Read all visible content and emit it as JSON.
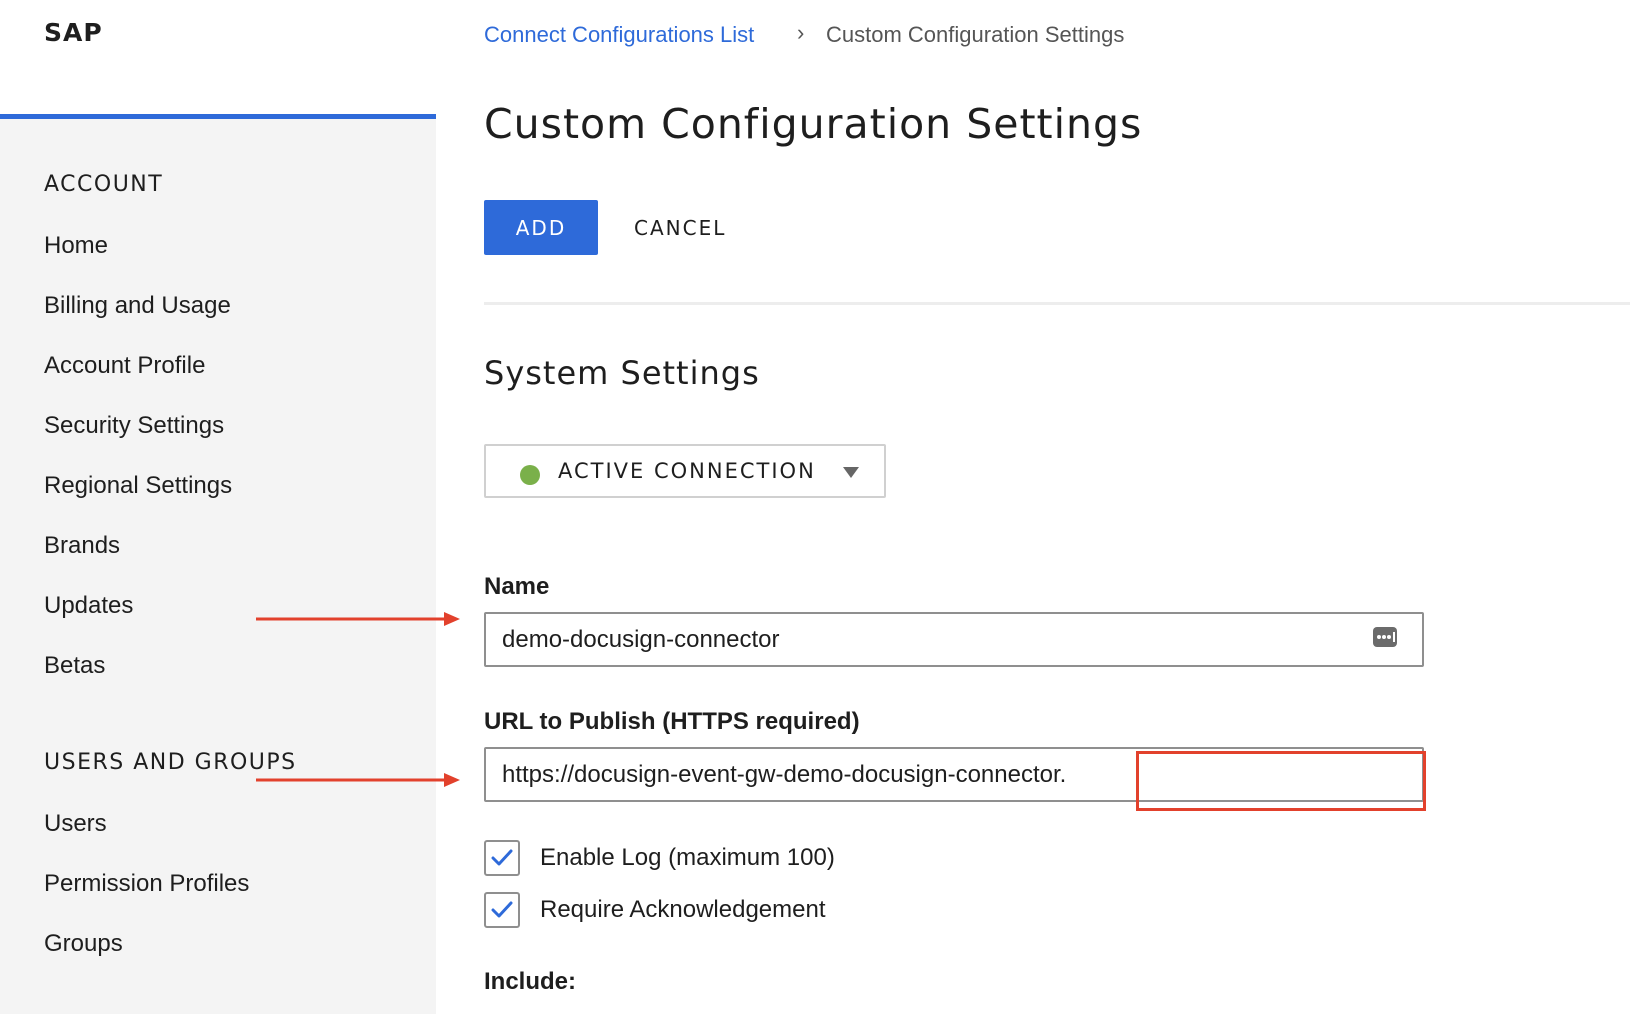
{
  "app": {
    "brand": "SAP"
  },
  "sidebar": {
    "sections": [
      {
        "heading": "ACCOUNT",
        "items": [
          "Home",
          "Billing and Usage",
          "Account Profile",
          "Security Settings",
          "Regional Settings",
          "Brands",
          "Updates",
          "Betas"
        ]
      },
      {
        "heading": "USERS AND GROUPS",
        "items": [
          "Users",
          "Permission Profiles",
          "Groups"
        ]
      }
    ]
  },
  "breadcrumb": {
    "parent": "Connect Configurations List",
    "separator": "›",
    "current": "Custom Configuration Settings"
  },
  "page": {
    "title": "Custom Configuration Settings"
  },
  "actions": {
    "add_label": "ADD",
    "cancel_label": "CANCEL"
  },
  "system_settings": {
    "title": "System Settings",
    "status": {
      "label": "ACTIVE CONNECTION",
      "color": "#7ab04a"
    },
    "name_field": {
      "label": "Name",
      "value": "demo-docusign-connector"
    },
    "url_field": {
      "label": "URL to Publish (HTTPS required)",
      "value": "https://docusign-event-gw-demo-docusign-connector."
    },
    "checkboxes": [
      {
        "label": "Enable Log (maximum 100)",
        "checked": true
      },
      {
        "label": "Require Acknowledgement",
        "checked": true
      }
    ],
    "include_label": "Include:"
  },
  "icons": {
    "password_manager": "password-manager-icon",
    "status": "status-dot-icon",
    "dropdown": "caret-down-icon",
    "checkmark": "checkmark-icon"
  },
  "colors": {
    "accent": "#2e6ad9",
    "annotation": "#e2412c",
    "status_active": "#7ab04a",
    "sidebar_bg": "#f4f4f4"
  }
}
